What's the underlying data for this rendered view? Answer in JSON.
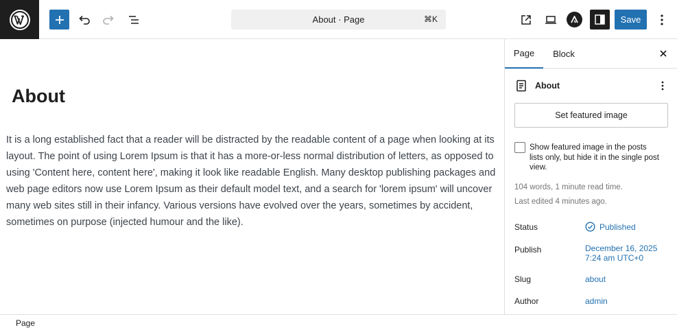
{
  "toolbar": {
    "command_bar_title": "About · Page",
    "command_bar_shortcut": "⌘K",
    "save_label": "Save"
  },
  "editor": {
    "title": "About",
    "body": "It is a long established fact that a reader will be distracted by the readable content of a page when looking at its layout. The point of using Lorem Ipsum is that it has a more-or-less normal distribution of letters, as opposed to using 'Content here, content here', making it look like readable English. Many desktop publishing packages and web page editors now use Lorem Ipsum as their default model text, and a search for 'lorem ipsum' will uncover many web sites still in their infancy. Various versions have evolved over the years, sometimes by accident, sometimes on purpose (injected humour and the like)."
  },
  "sidebar": {
    "tabs": [
      {
        "label": "Page",
        "active": true
      },
      {
        "label": "Block",
        "active": false
      }
    ],
    "document": {
      "title": "About",
      "featured_image_button": "Set featured image",
      "featured_checkbox_label": "Show featured image in the posts lists only, but hide it in the single post view.",
      "featured_checkbox_checked": false,
      "word_count": "104 words, 1 minute read time.",
      "last_edited": "Last edited 4 minutes ago."
    },
    "fields": {
      "status_label": "Status",
      "status_value": "Published",
      "publish_label": "Publish",
      "publish_date": "December 16, 2025",
      "publish_time": "7:24 am UTC+0",
      "slug_label": "Slug",
      "slug_value": "about",
      "author_label": "Author",
      "author_value": "admin"
    }
  },
  "footer": {
    "breadcrumb": "Page"
  },
  "colors": {
    "accent": "#2271b1",
    "dark": "#1e1e1e"
  }
}
